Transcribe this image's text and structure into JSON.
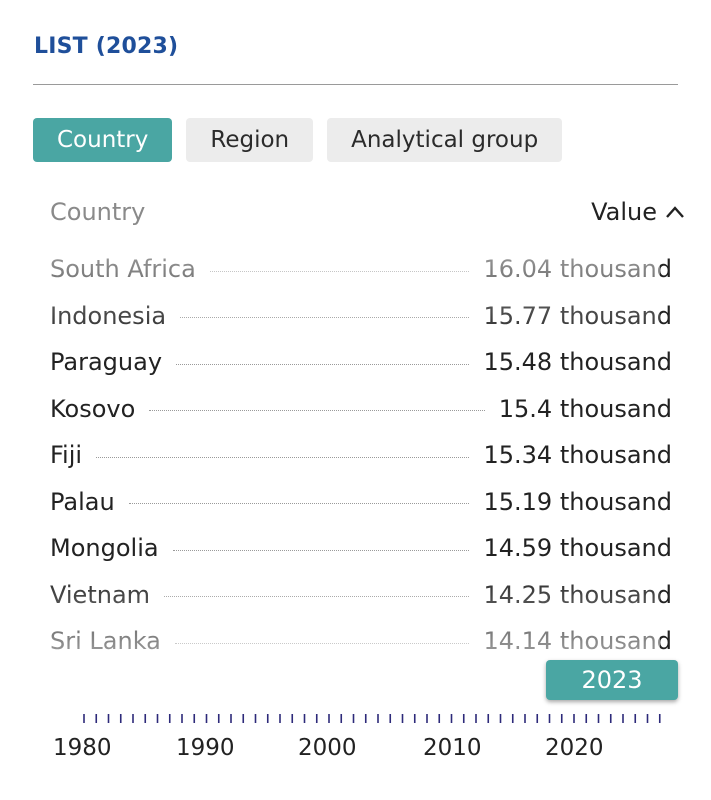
{
  "header": {
    "title": "LIST (2023)"
  },
  "tabs": [
    {
      "label": "Country",
      "active": true
    },
    {
      "label": "Region",
      "active": false
    },
    {
      "label": "Analytical group",
      "active": false
    }
  ],
  "table": {
    "col_country": "Country",
    "col_value": "Value",
    "sort_icon": "chevron-up-icon",
    "rows": [
      {
        "name": "South Africa",
        "value": "16.04 thousand"
      },
      {
        "name": "Indonesia",
        "value": "15.77 thousand"
      },
      {
        "name": "Paraguay",
        "value": "15.48 thousand"
      },
      {
        "name": "Kosovo",
        "value": "15.4 thousand"
      },
      {
        "name": "Fiji",
        "value": "15.34 thousand"
      },
      {
        "name": "Palau",
        "value": "15.19 thousand"
      },
      {
        "name": "Mongolia",
        "value": "14.59 thousand"
      },
      {
        "name": "Vietnam",
        "value": "14.25 thousand"
      },
      {
        "name": "Sri Lanka",
        "value": "14.14 thousand"
      }
    ]
  },
  "timeline": {
    "selected_year": "2023",
    "labels": [
      "1980",
      "1990",
      "2000",
      "2010",
      "2020"
    ]
  },
  "colors": {
    "accent": "#4aa6a3",
    "title": "#1f4f9a",
    "ticks": "#2d2a7a"
  }
}
